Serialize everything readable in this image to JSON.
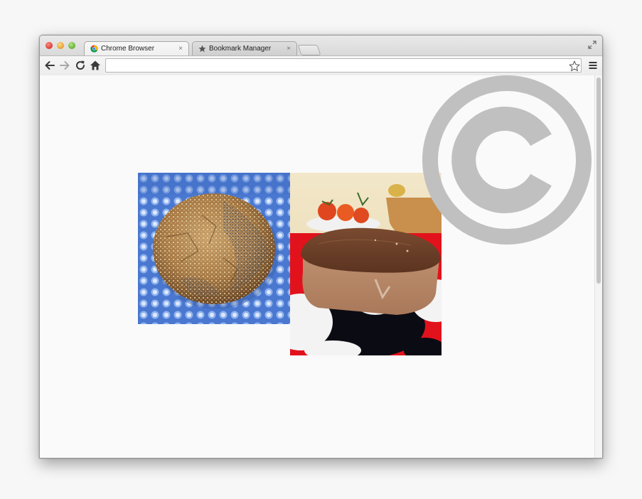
{
  "browser": {
    "tabs": [
      {
        "label": "Chrome Browser",
        "icon": "chrome-icon",
        "active": true,
        "close_label": "×"
      },
      {
        "label": "Bookmark Manager",
        "icon": "star-icon",
        "active": false,
        "close_label": "×"
      }
    ],
    "address": {
      "value": "",
      "placeholder": ""
    }
  },
  "content": {
    "images": [
      {
        "description_icon": "round-seeded-bread-photo"
      },
      {
        "description_icon": "loaf-bread-on-polka-dot-photo"
      }
    ],
    "watermark_icon": "copyright-icon"
  },
  "colors": {
    "close": "#e0443b",
    "minimize": "#e8a93a",
    "maximize": "#6fb83e",
    "watermark": "#c0c0c0"
  }
}
